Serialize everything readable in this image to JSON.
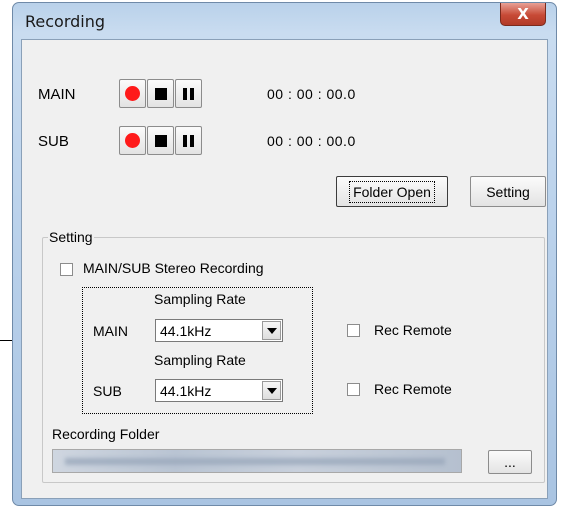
{
  "window": {
    "title": "Recording",
    "close_label": "X"
  },
  "transport": [
    {
      "label": "MAIN",
      "time": "00 : 00 : 00.0"
    },
    {
      "label": "SUB",
      "time": "00 : 00 : 00.0"
    }
  ],
  "actions": {
    "folder_open_label": "Folder Open",
    "setting_label": "Setting"
  },
  "setting_group": {
    "legend": "Setting",
    "stereo_label": "MAIN/SUB Stereo Recording",
    "stereo_checked": false,
    "rows": [
      {
        "label": "MAIN",
        "sampling_label": "Sampling Rate",
        "sampling_value": "44.1kHz",
        "rec_remote_label": "Rec Remote",
        "rec_remote_checked": false
      },
      {
        "label": "SUB",
        "sampling_label": "Sampling Rate",
        "sampling_value": "44.1kHz",
        "rec_remote_label": "Rec Remote",
        "rec_remote_checked": false
      }
    ],
    "recording_folder_label": "Recording Folder",
    "browse_label": "..."
  },
  "colors": {
    "record": "#ff1a1a",
    "close_button": "#c74a36",
    "titlebar": "#b9d1ea"
  },
  "icons": {
    "record": "record-icon",
    "stop": "stop-icon",
    "pause": "pause-icon",
    "close": "close-icon"
  }
}
